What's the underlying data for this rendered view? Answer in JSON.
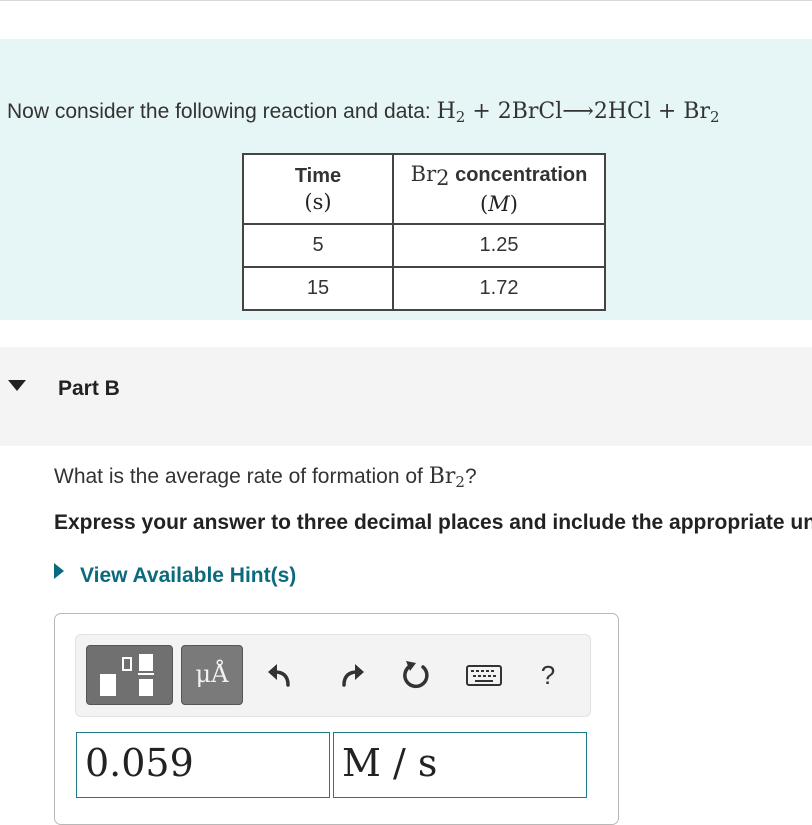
{
  "intro": {
    "text": "Now consider the following reaction and data: ",
    "equation": {
      "p1": "H",
      "s1": "2",
      "p2": " + 2BrCl⟶2HCl + Br",
      "s2": "2"
    }
  },
  "table": {
    "col1_header": "Time",
    "col1_unit": "(s)",
    "col2_header_chem": "Br",
    "col2_header_sub": "2",
    "col2_header_text": " concentration",
    "col2_unit_open": "(",
    "col2_unit": "M",
    "col2_unit_close": ")",
    "rows": [
      {
        "time": "5",
        "conc": "1.25"
      },
      {
        "time": "15",
        "conc": "1.72"
      }
    ]
  },
  "part": {
    "label": "Part B"
  },
  "question": {
    "text": "What is the average rate of formation of ",
    "chem": "Br",
    "sub": "2",
    "tail": "?"
  },
  "instruction": "Express your answer to three decimal places and include the appropriate units.",
  "hint": {
    "label": "View Available Hint(s)"
  },
  "toolbar": {
    "units_label": "μÅ",
    "help_label": "?"
  },
  "answer": {
    "value": "0.059",
    "units": "M / s"
  },
  "colors": {
    "intro_bg": "#e6f6f6",
    "hint_link": "#0b6b7e",
    "field_border": "#1e7a86"
  }
}
